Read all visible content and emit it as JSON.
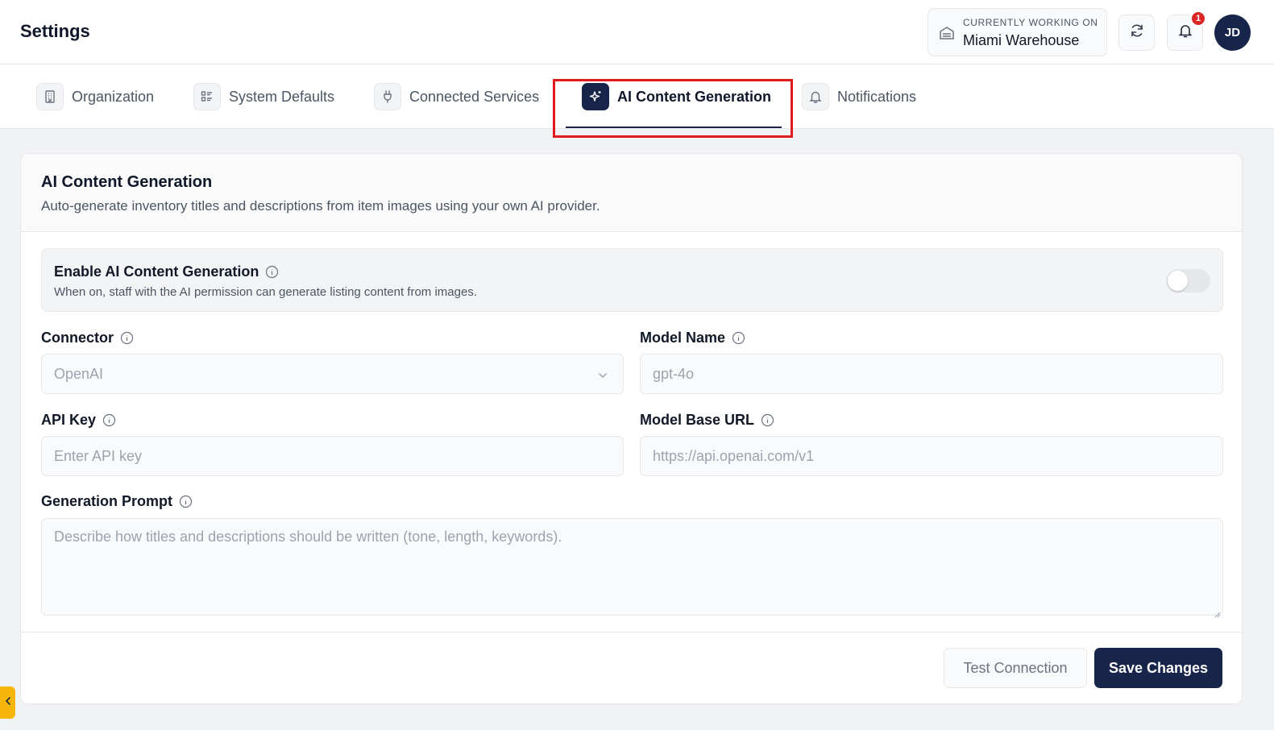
{
  "header": {
    "title": "Settings",
    "workspace_caption": "CURRENTLY WORKING ON",
    "workspace_name": "Miami Warehouse",
    "notification_count": "1",
    "avatar_initials": "JD"
  },
  "tabs": [
    {
      "label": "Organization",
      "icon": "building-icon",
      "active": false
    },
    {
      "label": "System Defaults",
      "icon": "list-icon",
      "active": false
    },
    {
      "label": "Connected Services",
      "icon": "plug-icon",
      "active": false
    },
    {
      "label": "AI Content Generation",
      "icon": "sparkles-icon",
      "active": true
    },
    {
      "label": "Notifications",
      "icon": "bell-icon",
      "active": false
    }
  ],
  "card": {
    "title": "AI Content Generation",
    "description": "Auto-generate inventory titles and descriptions from item images using your own AI provider.",
    "toggle": {
      "title": "Enable AI Content Generation",
      "description": "When on, staff with the AI permission can generate listing content from images.",
      "enabled": false
    },
    "fields": {
      "connector": {
        "label": "Connector",
        "value": "OpenAI"
      },
      "model_name": {
        "label": "Model Name",
        "placeholder": "gpt-4o"
      },
      "api_key": {
        "label": "API Key",
        "placeholder": "Enter API key"
      },
      "model_base_url": {
        "label": "Model Base URL",
        "placeholder": "https://api.openai.com/v1"
      },
      "prompt": {
        "label": "Generation Prompt",
        "placeholder": "Describe how titles and descriptions should be written (tone, length, keywords)."
      }
    },
    "buttons": {
      "test": "Test Connection",
      "save": "Save Changes"
    }
  },
  "colors": {
    "accent": "#17254a",
    "highlight": "#e01b1b",
    "badge": "#dc2626",
    "sidebar_toggle": "#f5b50a"
  }
}
